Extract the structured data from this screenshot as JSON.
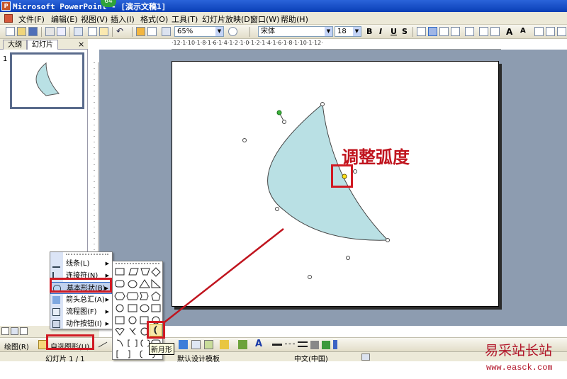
{
  "window": {
    "title": "Microsoft PowerPoint - [演示文稿1]",
    "app_icon": "P",
    "badge": "64"
  },
  "menubar": {
    "items": [
      "文件(F)",
      "编辑(E)",
      "视图(V)",
      "插入(I)",
      "格式(O)",
      "工具(T)",
      "幻灯片放映(D)",
      "窗口(W)",
      "帮助(H)"
    ]
  },
  "toolbar": {
    "zoom": "65%",
    "font_name": "宋体",
    "font_size": "18",
    "bold": "B",
    "italic": "I",
    "underline": "U",
    "shadow": "S",
    "font_grow": "A",
    "font_shrink": "A"
  },
  "leftpane": {
    "tabs": [
      "大纲",
      "幻灯片"
    ],
    "close": "×",
    "slide_number": "1"
  },
  "ruler": {
    "horizontal": "·12·1·10·1·8·1·6·1·4·1·2·1·0·1·2·1·4·1·6·1·8·1·10·1·12·"
  },
  "slide": {
    "shape": "moon",
    "shape_fill": "#b9e0e4",
    "callout": "调整弧度"
  },
  "drawbar": {
    "draw_label": "绘图(R)",
    "autoshape_label": "自选图形(U)"
  },
  "autoshape_menu": {
    "items": [
      {
        "label": "线条(L)",
        "icon": "lines-icon"
      },
      {
        "label": "连接符(N)",
        "icon": "connector-icon"
      },
      {
        "label": "基本形状(B)",
        "icon": "basic-shapes-icon",
        "selected": true
      },
      {
        "label": "箭头总汇(A)",
        "icon": "block-arrows-icon"
      },
      {
        "label": "流程图(F)",
        "icon": "flowchart-icon"
      },
      {
        "label": "动作按钮(I)",
        "icon": "action-button-icon"
      }
    ]
  },
  "tooltip": "新月形",
  "statusbar": {
    "slide": "幻灯片 1 / 1",
    "template": "默认设计模板",
    "language": "中文(中国)"
  },
  "watermark": {
    "site_name": "易采站长站",
    "url": "www.easck.com"
  },
  "colors": {
    "accent_red": "#d01a23",
    "titlebar": "#0a3fb6"
  }
}
